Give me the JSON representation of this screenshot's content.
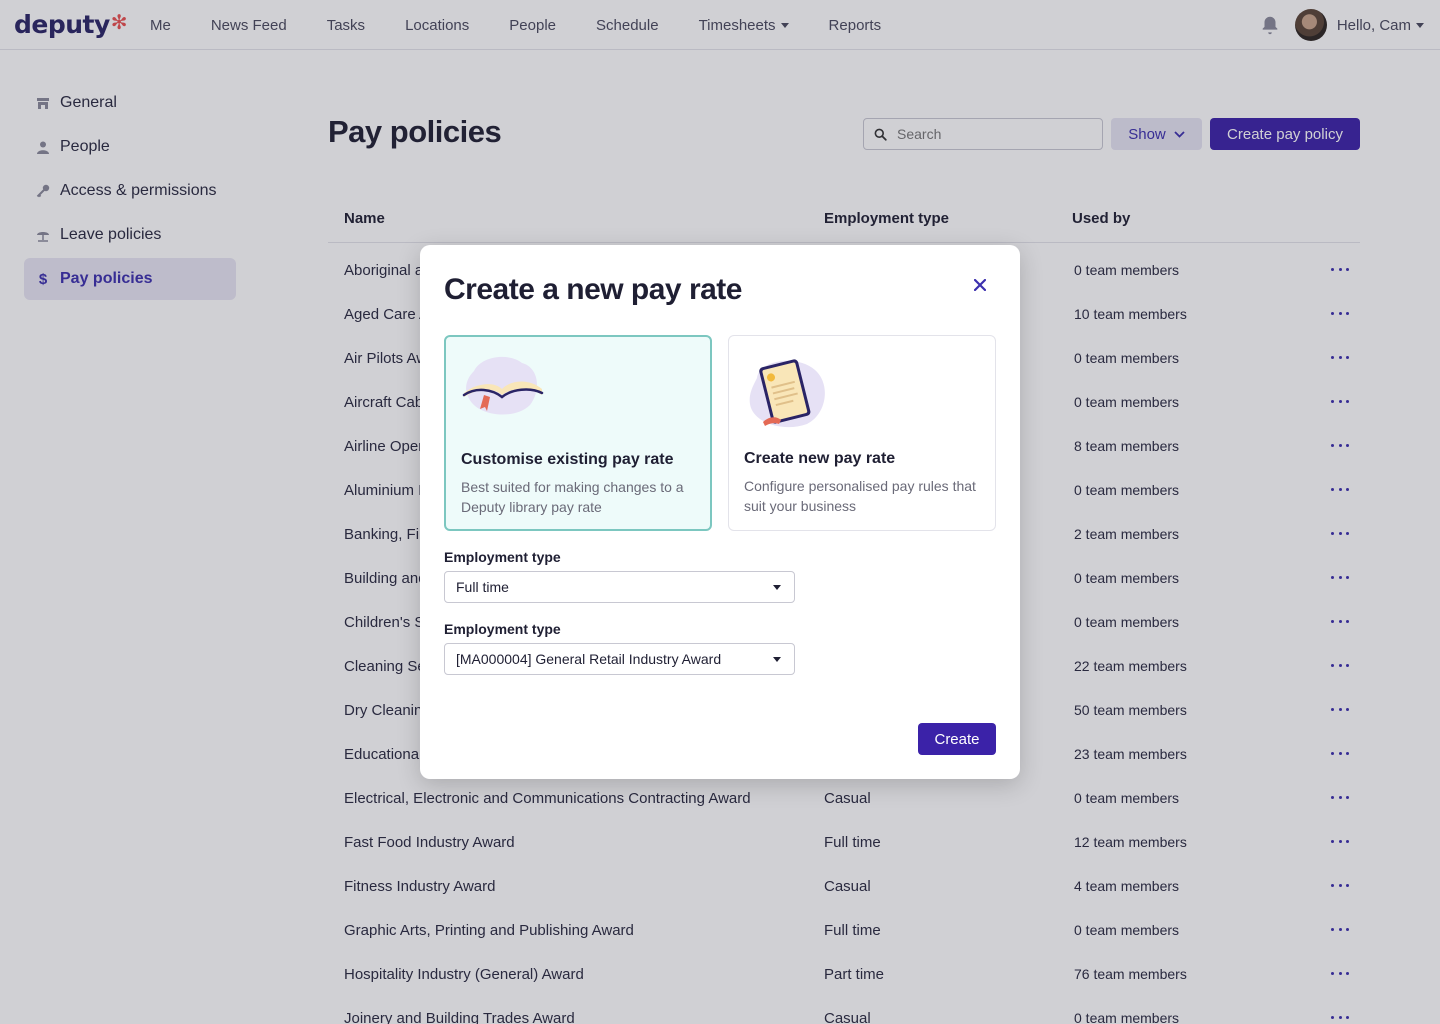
{
  "nav": {
    "logo": "deputy",
    "items": [
      {
        "label": "Me",
        "caret": false
      },
      {
        "label": "News Feed",
        "caret": false
      },
      {
        "label": "Tasks",
        "caret": false
      },
      {
        "label": "Locations",
        "caret": false
      },
      {
        "label": "People",
        "caret": false
      },
      {
        "label": "Schedule",
        "caret": false
      },
      {
        "label": "Timesheets",
        "caret": true
      },
      {
        "label": "Reports",
        "caret": false
      }
    ],
    "greeting": "Hello, Cam"
  },
  "sidebar": {
    "items": [
      {
        "label": "General",
        "icon": "store-icon",
        "active": false
      },
      {
        "label": "People",
        "icon": "person-icon",
        "active": false
      },
      {
        "label": "Access & permissions",
        "icon": "key-icon",
        "active": false
      },
      {
        "label": "Leave policies",
        "icon": "umbrella-icon",
        "active": false
      },
      {
        "label": "Pay policies",
        "icon": "dollar-icon",
        "active": true
      }
    ]
  },
  "main": {
    "title": "Pay policies",
    "search_placeholder": "Search",
    "show_label": "Show",
    "create_label": "Create pay policy"
  },
  "table": {
    "headers": {
      "name": "Name",
      "type": "Employment type",
      "used": "Used by"
    },
    "rows": [
      {
        "name": "Aboriginal a",
        "type": "",
        "used": "0 team members"
      },
      {
        "name": "Aged Care A",
        "type": "",
        "used": "10 team members"
      },
      {
        "name": "Air Pilots Aw",
        "type": "",
        "used": "0 team members"
      },
      {
        "name": "Aircraft Cab",
        "type": "",
        "used": "0 team members"
      },
      {
        "name": "Airline Oper",
        "type": "",
        "used": "8 team members"
      },
      {
        "name": "Aluminium I",
        "type": "",
        "used": "0 team members"
      },
      {
        "name": "Banking, Fin",
        "type": "",
        "used": "2 team members"
      },
      {
        "name": "Building and",
        "type": "",
        "used": "0 team members"
      },
      {
        "name": "Children's S",
        "type": "",
        "used": "0 team members"
      },
      {
        "name": "Cleaning Se",
        "type": "",
        "used": "22 team members"
      },
      {
        "name": "Dry Cleanin",
        "type": "",
        "used": "50 team members"
      },
      {
        "name": "Educational",
        "type": "",
        "used": "23 team members"
      },
      {
        "name": "Electrical, Electronic and Communications Contracting Award",
        "type": "Casual",
        "used": "0 team members"
      },
      {
        "name": "Fast Food Industry Award",
        "type": "Full time",
        "used": "12 team members"
      },
      {
        "name": "Fitness Industry Award",
        "type": "Casual",
        "used": "4 team members"
      },
      {
        "name": "Graphic Arts, Printing and Publishing Award",
        "type": "Full time",
        "used": "0 team members"
      },
      {
        "name": "Hospitality Industry (General) Award",
        "type": "Part time",
        "used": "76 team members"
      },
      {
        "name": "Joinery and Building Trades Award",
        "type": "Casual",
        "used": "0 team members"
      }
    ]
  },
  "modal": {
    "title": "Create a new pay rate",
    "options": [
      {
        "title": "Customise existing pay rate",
        "desc": "Best suited for making changes to a Deputy library pay rate",
        "selected": true
      },
      {
        "title": "Create new pay rate",
        "desc": "Configure personalised pay rules that suit your business",
        "selected": false
      }
    ],
    "field1_label": "Employment type",
    "field1_value": "Full time",
    "field2_label": "Employment type",
    "field2_value": "[MA000004] General Retail Industry Award",
    "create_label": "Create"
  },
  "colors": {
    "brand": "#3b22a8",
    "logo_star": "#e94f4f",
    "selected_border": "#7cc7c0"
  }
}
